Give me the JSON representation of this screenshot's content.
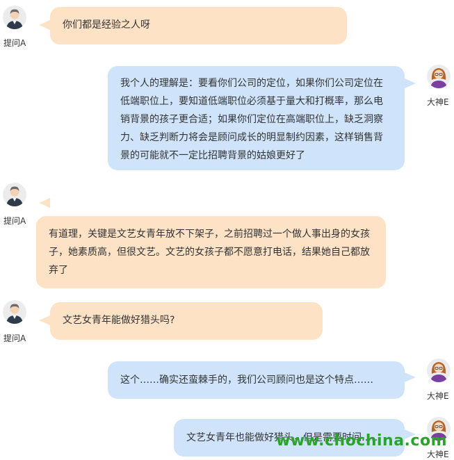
{
  "messages": [
    {
      "side": "left",
      "name": "提问A",
      "avatar": "male-avatar-icon",
      "text": "你们都是经验之人呀"
    },
    {
      "side": "right",
      "name": "大神E",
      "avatar": "female-avatar-icon",
      "text": " 我个人的理解是：要看你们公司的定位，如果你们公司定位在低端职位上，要知道低端职位必须基于量大和打概率，那么电销背景的孩子更合适；如果你们定位在高端职位上，缺乏洞察力、缺乏判断力将会是顾问成长的明显制约因素，这样销售背景的可能就不一定比招聘背景的姑娘更好了"
    },
    {
      "side": "left",
      "name": "提问A",
      "avatar": "male-avatar-icon",
      "text": "有道理，关键是文艺女青年放不下架子，之前招聘过一个做人事出身的女孩子，她素质高，但很文艺。文艺的女孩子都不愿意打电话，结果她自己都放弃了"
    },
    {
      "side": "left",
      "name": "提问A",
      "avatar": "male-avatar-icon",
      "text": "文艺女青年能做好猎头吗?"
    },
    {
      "side": "right",
      "name": "大神E",
      "avatar": "female-avatar-icon",
      "text": "这个……确实还蛮棘手的，我们公司顾问也是这个特点……"
    },
    {
      "side": "right",
      "name": "大神E",
      "avatar": "female-avatar-icon",
      "text": "文艺女青年也能做好猎头，但是需要时间……"
    }
  ],
  "watermark": "www.chochina.com",
  "colors": {
    "left_bubble": "#fde2c6",
    "right_bubble": "#cfe4fb",
    "watermark": "#2aa52a"
  }
}
